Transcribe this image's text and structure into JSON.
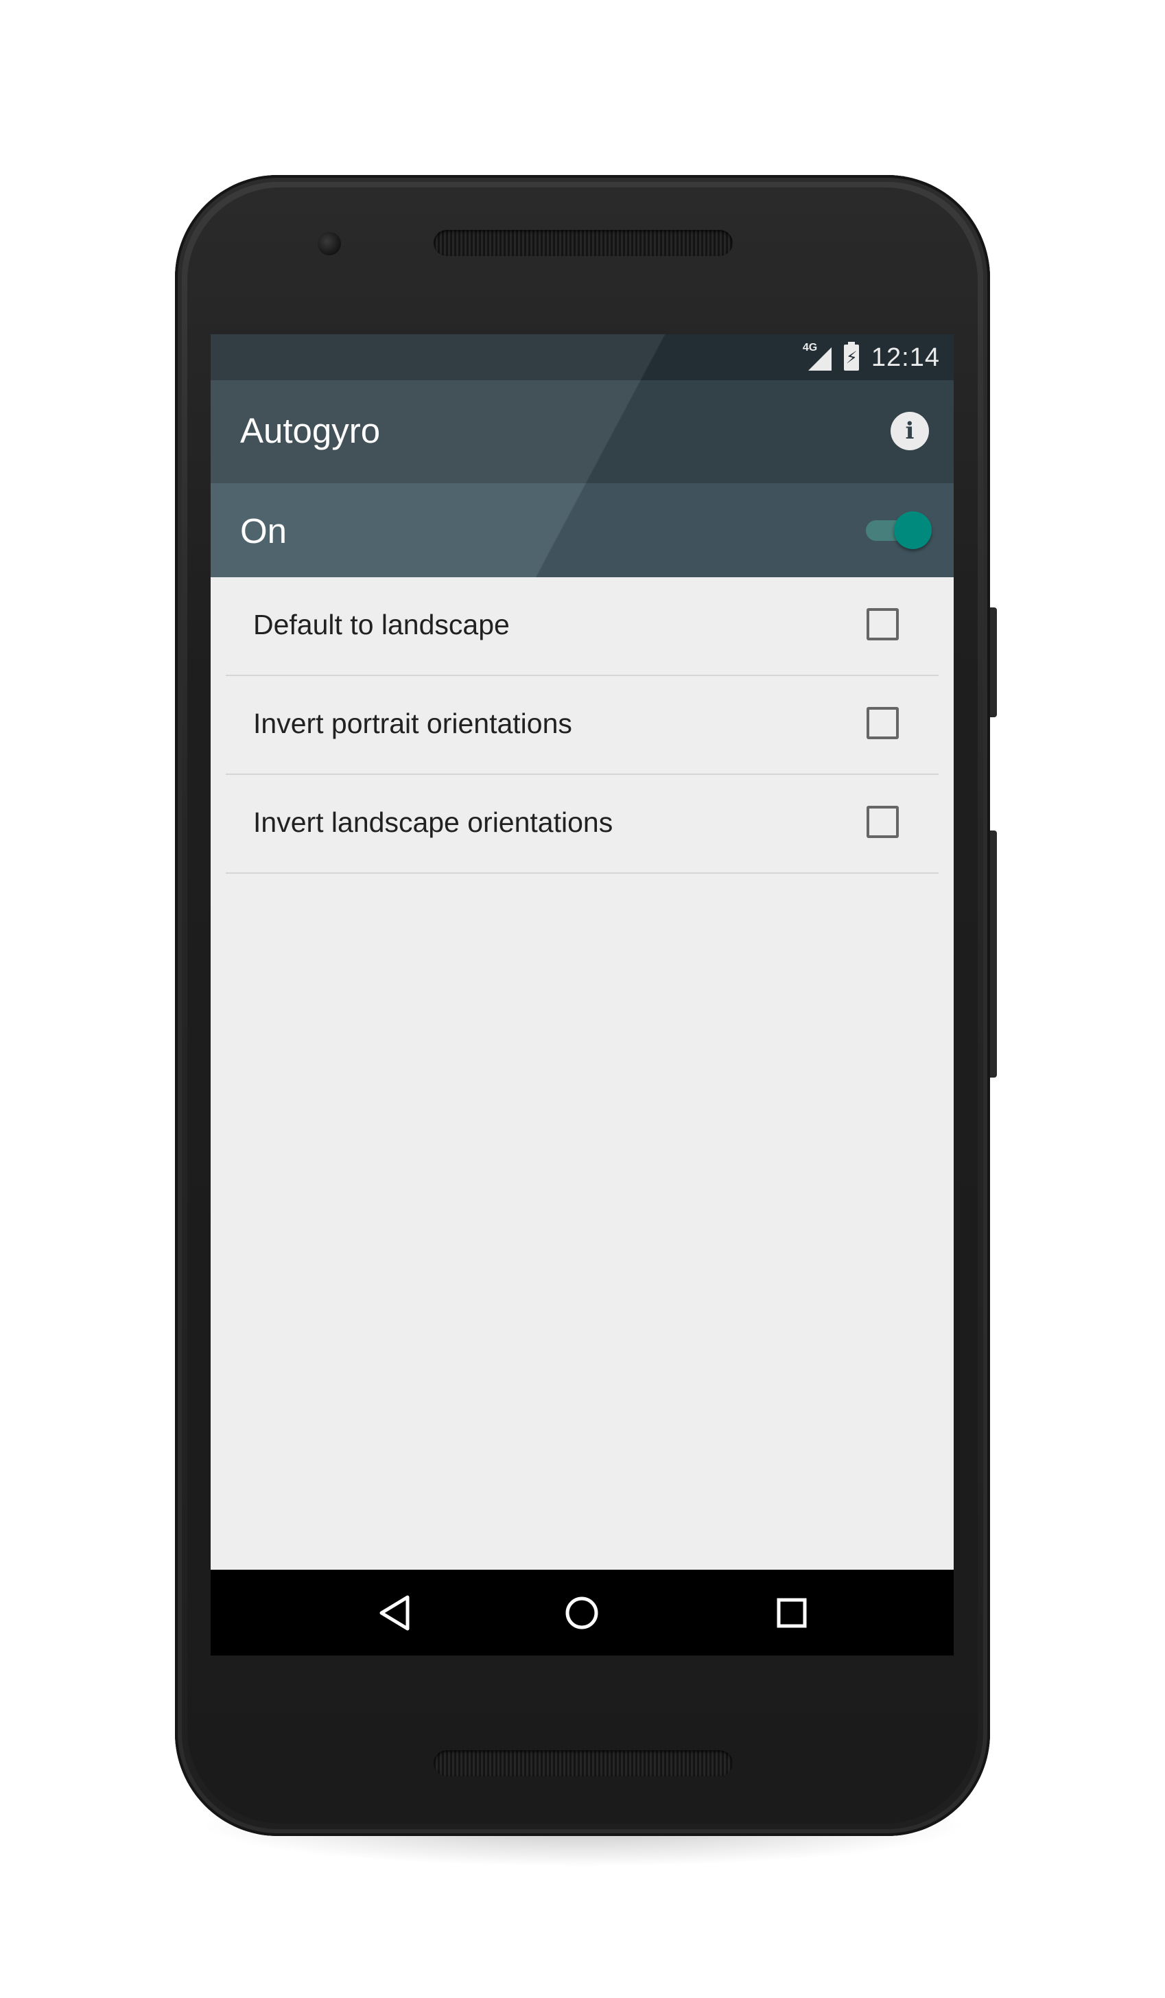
{
  "status_bar": {
    "network_label": "4G",
    "clock": "12:14"
  },
  "app_bar": {
    "title": "Autogyro",
    "info_icon": "info-icon"
  },
  "master_switch": {
    "label": "On",
    "checked": true,
    "accent_color": "#009688"
  },
  "settings": [
    {
      "label": "Default to landscape",
      "checked": false
    },
    {
      "label": "Invert portrait orientations",
      "checked": false
    },
    {
      "label": "Invert landscape orientations",
      "checked": false
    }
  ],
  "nav_bar": {
    "back_icon": "back-icon",
    "home_icon": "home-icon",
    "recents_icon": "recents-icon"
  },
  "colors": {
    "status_bar": "#263238",
    "app_bar": "#37474f",
    "switch_bar": "#455a64",
    "background": "#eeeeee"
  }
}
